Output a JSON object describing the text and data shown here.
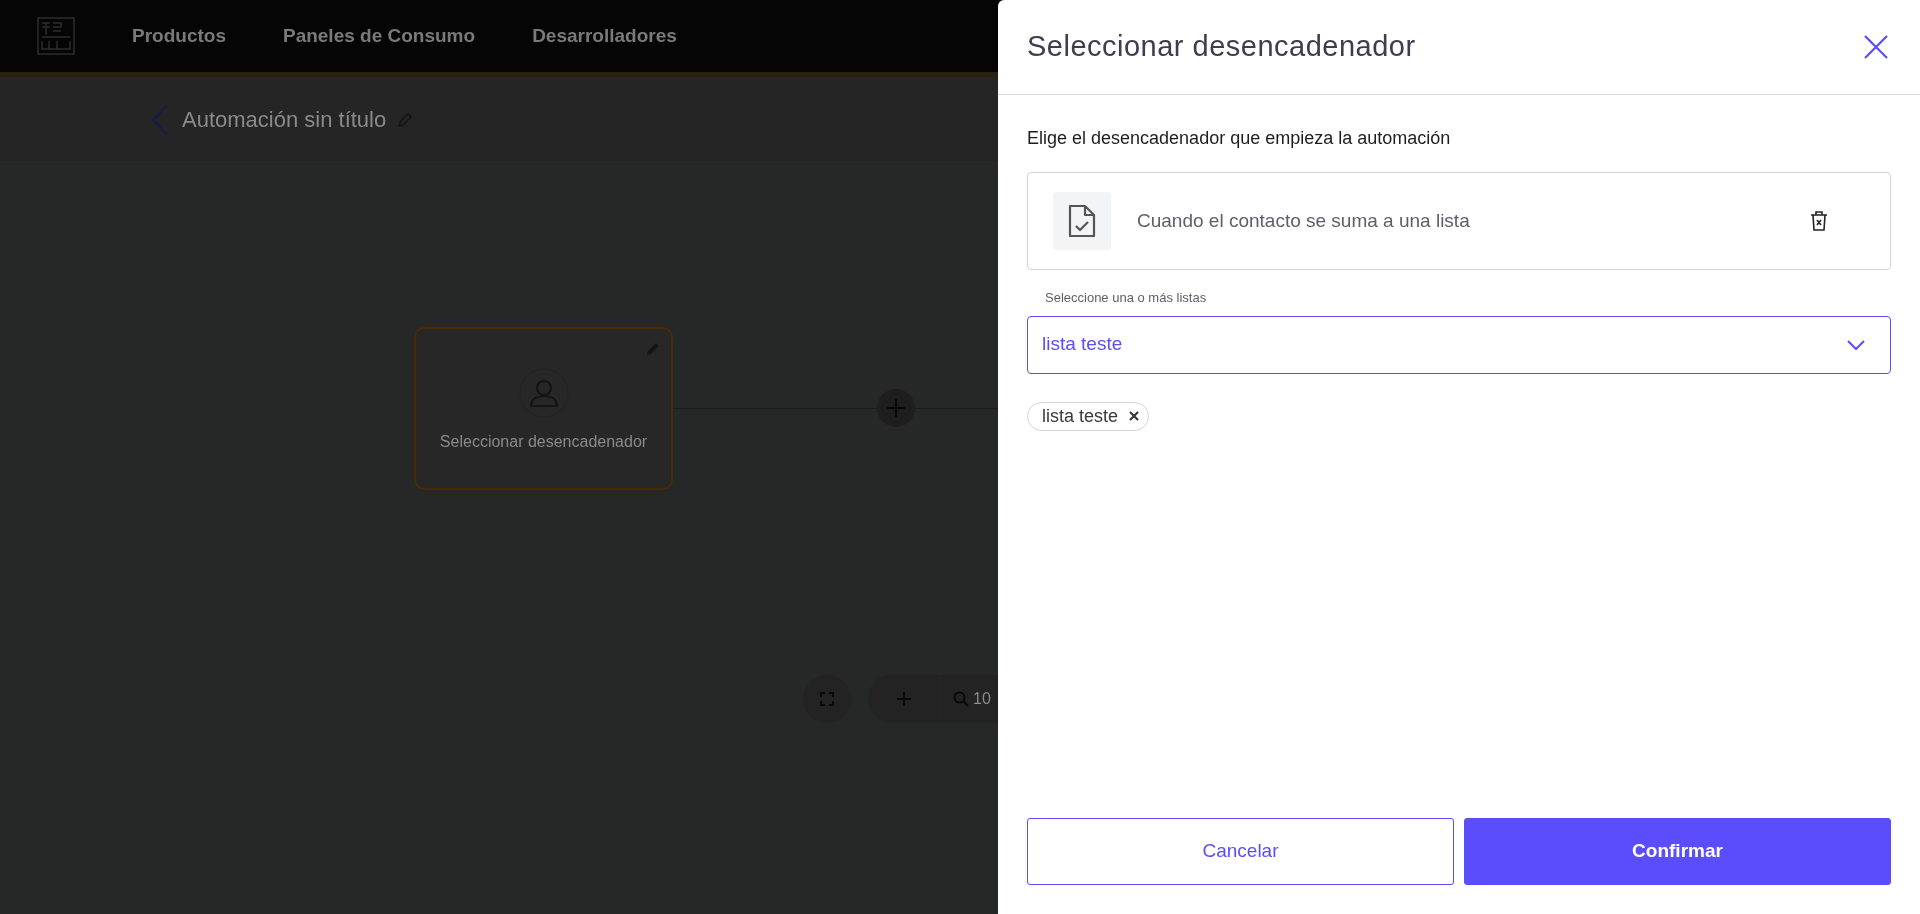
{
  "nav": {
    "items": [
      {
        "label": "Productos"
      },
      {
        "label": "Paneles de Consumo"
      },
      {
        "label": "Desarrolladores"
      }
    ]
  },
  "automation": {
    "title": "Automación sin título"
  },
  "canvas": {
    "node": {
      "label": "Seleccionar desencadenador",
      "selected": true
    },
    "zoom_text": "10"
  },
  "panel": {
    "title": "Seleccionar desencadenador",
    "subtitle": "Elige el desencadenador que empieza la automación",
    "trigger": {
      "label": "Cuando el contacto se suma a una lista"
    },
    "list_select": {
      "label": "Seleccione una o más listas",
      "value": "lista teste"
    },
    "chips": [
      {
        "label": "lista teste"
      }
    ],
    "buttons": [
      {
        "label": "Cancelar",
        "kind": "secondary"
      },
      {
        "label": "Confirmar",
        "kind": "primary"
      }
    ]
  }
}
